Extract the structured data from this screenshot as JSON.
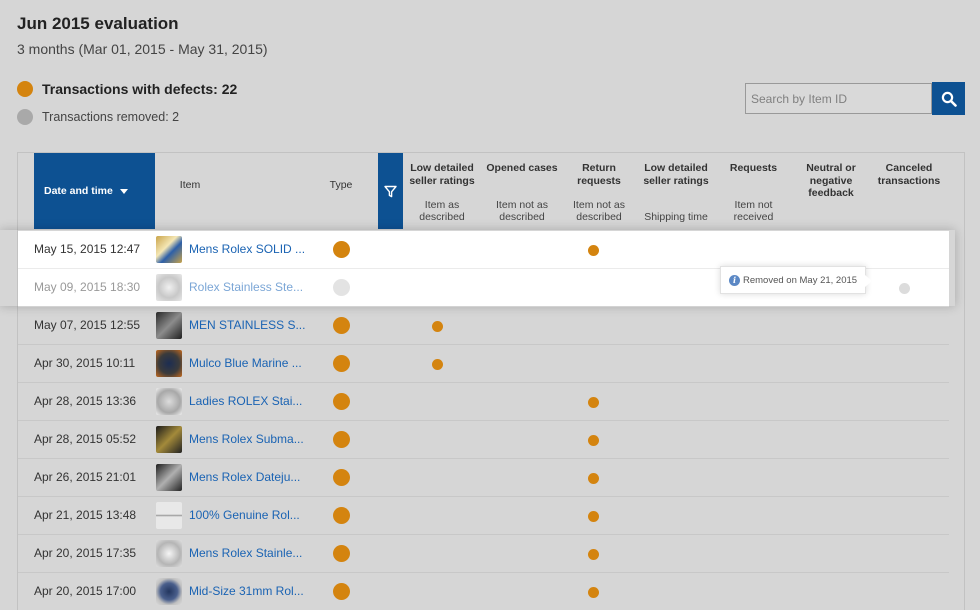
{
  "page": {
    "title": "Jun 2015 evaluation",
    "subtitle": "3 months (Mar 01, 2015 - May 31, 2015)"
  },
  "legend": {
    "defects": "Transactions with defects: 22",
    "removed": "Transactions removed: 2"
  },
  "search": {
    "placeholder": "Search by Item ID",
    "button_icon": "search-icon"
  },
  "colors": {
    "brand_blue": "#0d5192",
    "defect_orange": "#d4840f",
    "removed_grey": "#a9a9a9",
    "link_blue": "#1a63b3"
  },
  "table": {
    "headers": {
      "date": "Date and time",
      "item": "Item",
      "type": "Type",
      "filter_icon": "filter-icon",
      "metrics": [
        {
          "main": "Low detailed seller ratings",
          "sub": "Item as described"
        },
        {
          "main": "Opened cases",
          "sub": "Item not as described"
        },
        {
          "main": "Return requests",
          "sub": "Item not as described"
        },
        {
          "main": "Low detailed seller ratings",
          "sub": "Shipping time"
        },
        {
          "main": "Requests",
          "sub": "Item not received"
        },
        {
          "main": "Neutral or negative feedback",
          "sub": ""
        },
        {
          "main": "Canceled transactions",
          "sub": ""
        }
      ]
    },
    "rows": [
      {
        "date": "May 15, 2015 12:47",
        "item": "Mens Rolex SOLID ...",
        "removed": false,
        "metric": 2
      },
      {
        "date": "May 09, 2015 18:30",
        "item": "Rolex Stainless Ste...",
        "removed": true,
        "metric": 6
      },
      {
        "date": "May 07, 2015 12:55",
        "item": "MEN STAINLESS S...",
        "removed": false,
        "metric": 0
      },
      {
        "date": "Apr 30, 2015 10:11",
        "item": "Mulco Blue Marine ...",
        "removed": false,
        "metric": 0
      },
      {
        "date": "Apr 28, 2015 13:36",
        "item": "Ladies ROLEX Stai...",
        "removed": false,
        "metric": 2
      },
      {
        "date": "Apr 28, 2015 05:52",
        "item": "Mens Rolex Subma...",
        "removed": false,
        "metric": 2
      },
      {
        "date": "Apr 26, 2015 21:01",
        "item": "Mens Rolex Dateju...",
        "removed": false,
        "metric": 2
      },
      {
        "date": "Apr 21, 2015 13:48",
        "item": "100% Genuine Rol...",
        "removed": false,
        "metric": 2
      },
      {
        "date": "Apr 20, 2015 17:35",
        "item": "Mens Rolex Stainle...",
        "removed": false,
        "metric": 2
      },
      {
        "date": "Apr 20, 2015 17:00",
        "item": "Mid-Size 31mm Rol...",
        "removed": false,
        "metric": 2
      }
    ]
  },
  "tooltip": {
    "text": "Removed on May 21, 2015",
    "icon": "info-icon"
  }
}
